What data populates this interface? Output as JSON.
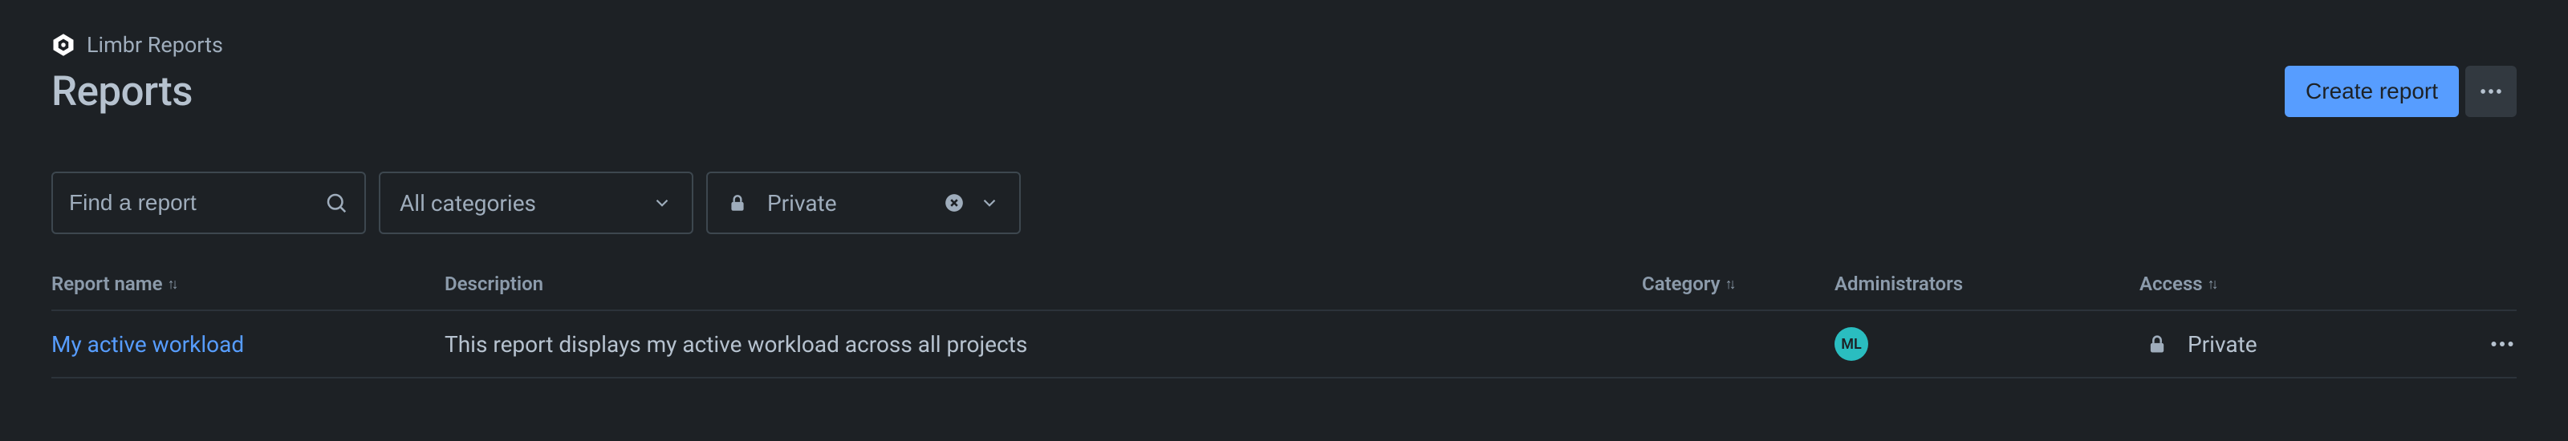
{
  "breadcrumb": {
    "label": "Limbr Reports"
  },
  "header": {
    "title": "Reports",
    "create_label": "Create report"
  },
  "filters": {
    "search_placeholder": "Find a report",
    "category_select": {
      "label": "All categories"
    },
    "access_chip": {
      "label": "Private"
    }
  },
  "table": {
    "columns": {
      "name": "Report name",
      "description": "Description",
      "category": "Category",
      "administrators": "Administrators",
      "access": "Access"
    },
    "rows": [
      {
        "name": "My active workload",
        "description": "This report displays my active workload across all projects",
        "category": "",
        "admin_initials": "ML",
        "access": "Private"
      }
    ]
  },
  "colors": {
    "accent": "#579dff",
    "avatar": "#2abdc0"
  }
}
